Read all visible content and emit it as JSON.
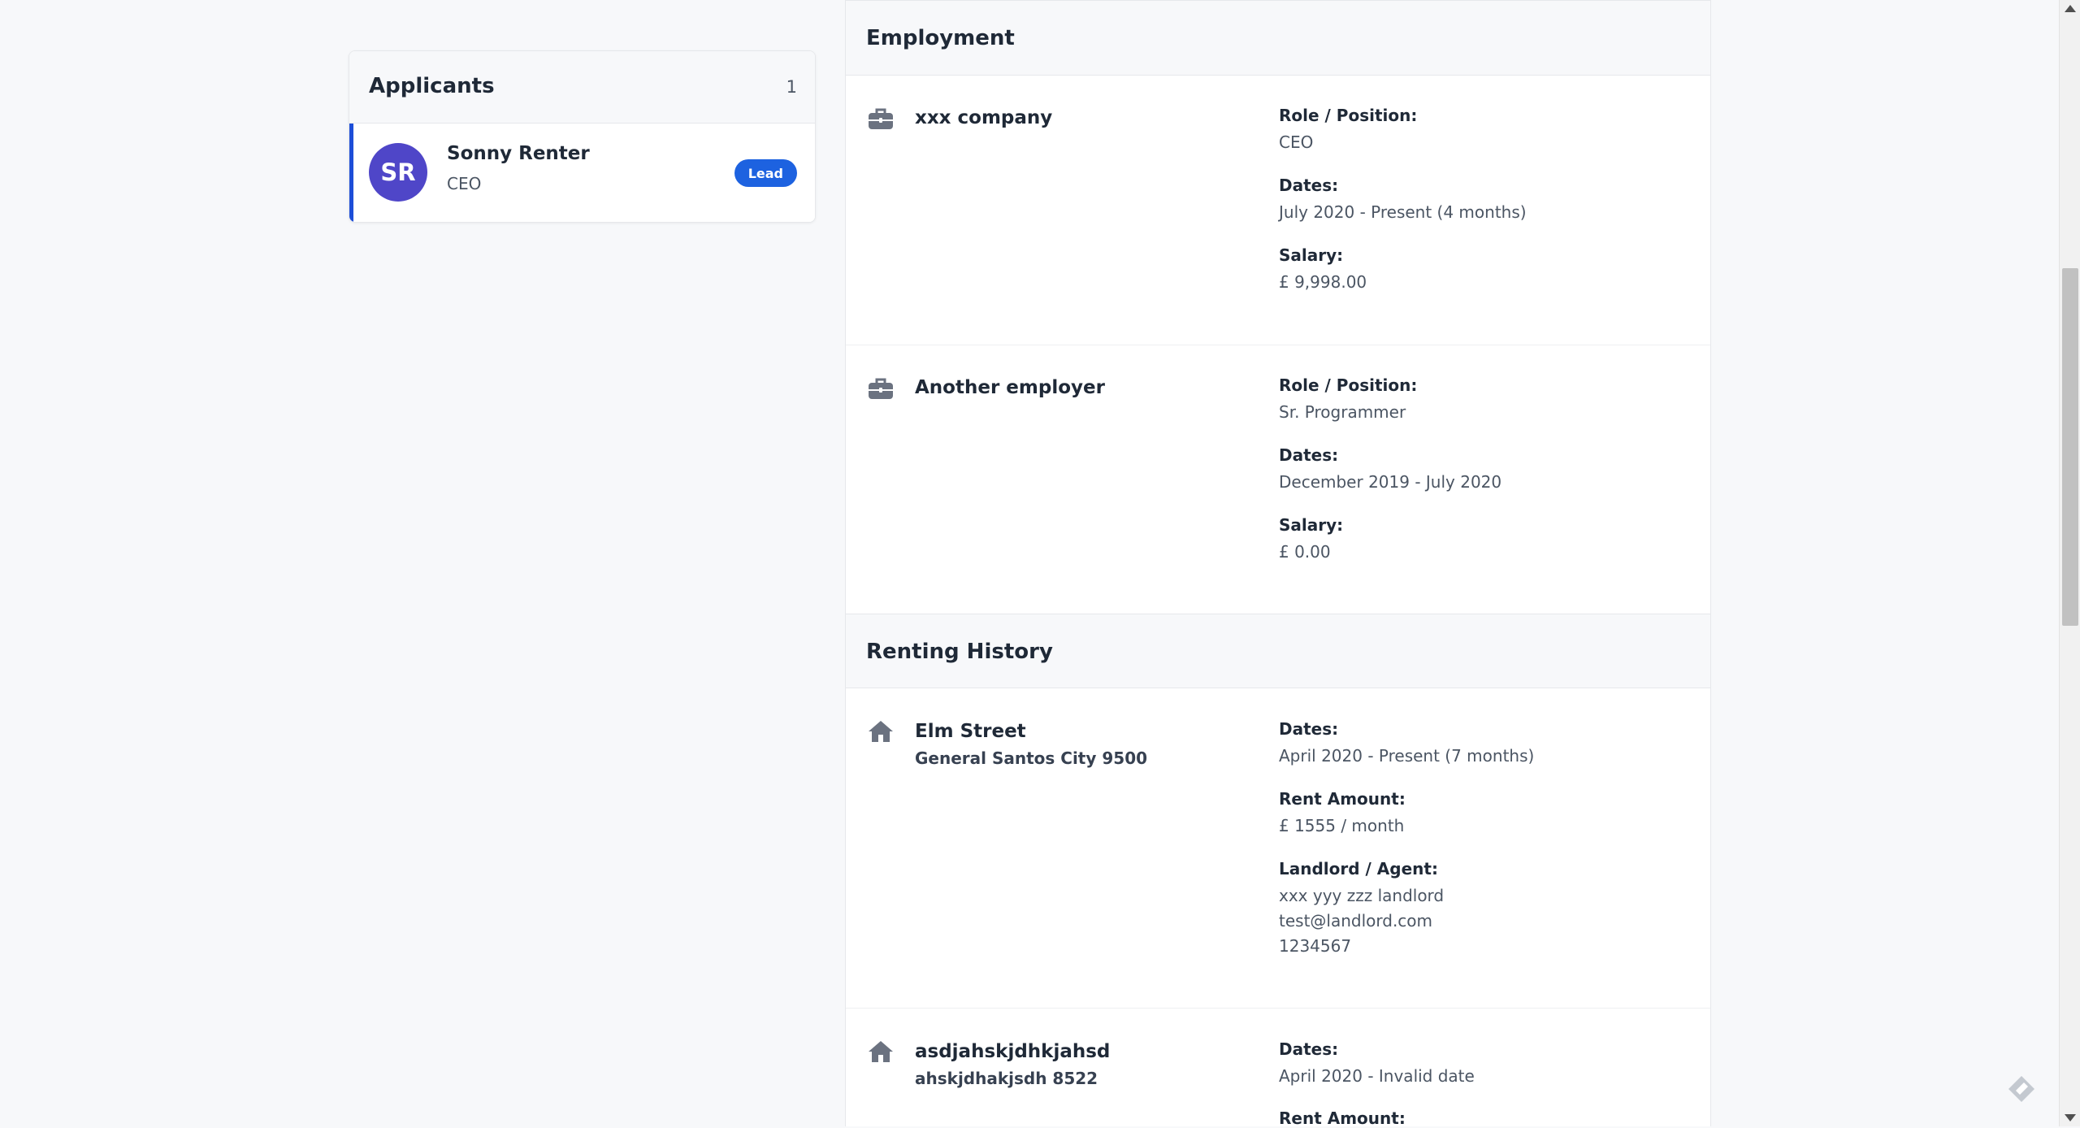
{
  "applicants": {
    "title": "Applicants",
    "count": "1",
    "items": [
      {
        "initials": "SR",
        "name": "Sonny Renter",
        "role": "CEO",
        "badge": "Lead"
      }
    ]
  },
  "employment": {
    "title": "Employment",
    "entries": [
      {
        "icon": "briefcase-icon",
        "company": "xxx company",
        "role_label": "Role / Position:",
        "role": "CEO",
        "dates_label": "Dates:",
        "dates": "July 2020 - Present (4 months)",
        "salary_label": "Salary:",
        "salary": "£ 9,998.00"
      },
      {
        "icon": "briefcase-icon",
        "company": "Another employer",
        "role_label": "Role / Position:",
        "role": "Sr. Programmer",
        "dates_label": "Dates:",
        "dates": "December 2019 - July 2020",
        "salary_label": "Salary:",
        "salary": "£ 0.00"
      }
    ]
  },
  "renting_history": {
    "title": "Renting History",
    "entries": [
      {
        "icon": "home-icon",
        "street": "Elm Street",
        "city": "General Santos City 9500",
        "dates_label": "Dates:",
        "dates": "April 2020 - Present (7 months)",
        "rent_label": "Rent Amount:",
        "rent": "£ 1555 / month",
        "landlord_label": "Landlord / Agent:",
        "landlord_name": "xxx yyy zzz landlord",
        "landlord_email": "test@landlord.com",
        "landlord_phone": "1234567"
      },
      {
        "icon": "home-icon",
        "street": "asdjahskjdhkjahsd",
        "city": "ahskjdhakjsdh 8522",
        "dates_label": "Dates:",
        "dates": "April 2020 - Invalid date",
        "rent_label": "Rent Amount:"
      }
    ]
  },
  "colors": {
    "accent": "#1d62e0",
    "avatar": "#4f46c8",
    "page_bg": "#f7f8fa"
  }
}
